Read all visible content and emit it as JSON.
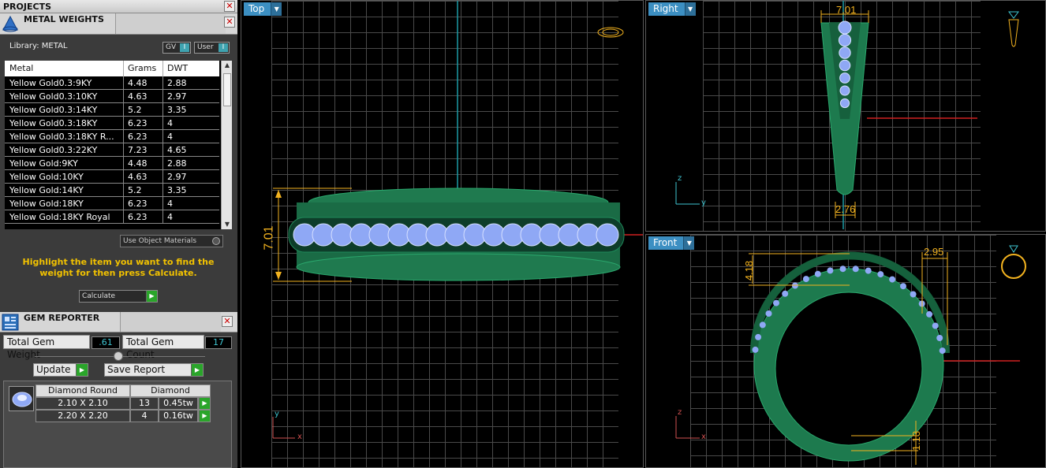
{
  "projects_panel": {
    "title": "PROJECTS"
  },
  "metal_weights": {
    "title": "METAL WEIGHTS",
    "library_label": "Library: METAL",
    "toggle_gv": "GV",
    "toggle_user": "User",
    "columns": [
      "Metal",
      "Grams",
      "DWT"
    ],
    "rows": [
      {
        "metal": "Yellow Gold0.3:9KY",
        "grams": "4.48",
        "dwt": "2.88"
      },
      {
        "metal": "Yellow Gold0.3:10KY",
        "grams": "4.63",
        "dwt": "2.97"
      },
      {
        "metal": "Yellow Gold0.3:14KY",
        "grams": "5.2",
        "dwt": "3.35"
      },
      {
        "metal": "Yellow Gold0.3:18KY",
        "grams": "6.23",
        "dwt": "4"
      },
      {
        "metal": "Yellow Gold0.3:18KY R...",
        "grams": "6.23",
        "dwt": "4"
      },
      {
        "metal": "Yellow Gold0.3:22KY",
        "grams": "7.23",
        "dwt": "4.65"
      },
      {
        "metal": "Yellow Gold:9KY",
        "grams": "4.48",
        "dwt": "2.88"
      },
      {
        "metal": "Yellow Gold:10KY",
        "grams": "4.63",
        "dwt": "2.97"
      },
      {
        "metal": "Yellow Gold:14KY",
        "grams": "5.2",
        "dwt": "3.35"
      },
      {
        "metal": "Yellow Gold:18KY",
        "grams": "6.23",
        "dwt": "4"
      },
      {
        "metal": "Yellow Gold:18KY Royal",
        "grams": "6.23",
        "dwt": "4"
      }
    ],
    "use_object_materials": "Use Object Materials",
    "hint": "Highlight the item you want to find the weight for then press Calculate.",
    "calculate_label": "Calculate"
  },
  "gem_reporter": {
    "title": "GEM REPORTER",
    "total_weight_label": "Total Gem Weight",
    "total_weight_value": ".61",
    "total_count_label": "Total Gem Count",
    "total_count_value": "17",
    "update_label": "Update",
    "save_report_label": "Save Report",
    "headers": [
      "Diamond Round",
      "Diamond"
    ],
    "rows": [
      {
        "size": "2.10 X 2.10",
        "count": "13",
        "weight": "0.45tw"
      },
      {
        "size": "2.20 X 2.20",
        "count": "4",
        "weight": "0.16tw"
      }
    ]
  },
  "viewports": {
    "top": {
      "label": "Top",
      "dimension": "7.01",
      "axis_y": "y",
      "axis_x": "x"
    },
    "right": {
      "label": "Right",
      "dim_top": "7.01",
      "dim_bottom": "2.76",
      "axis_z": "z",
      "axis_y": "y"
    },
    "front": {
      "label": "Front",
      "dim_left": "4.18",
      "dim_right": "2.95",
      "dim_bottom": "1.13",
      "axis_z": "z",
      "axis_x": "x"
    }
  },
  "colors": {
    "accent": "#3c8fc2",
    "gem_count": "#3ec3cf",
    "hint": "#f2c200",
    "dimension": "#f2b21f",
    "metal": "#1f8a5a",
    "gem": "#8fa8f5",
    "grid": "#4a4a4a"
  }
}
